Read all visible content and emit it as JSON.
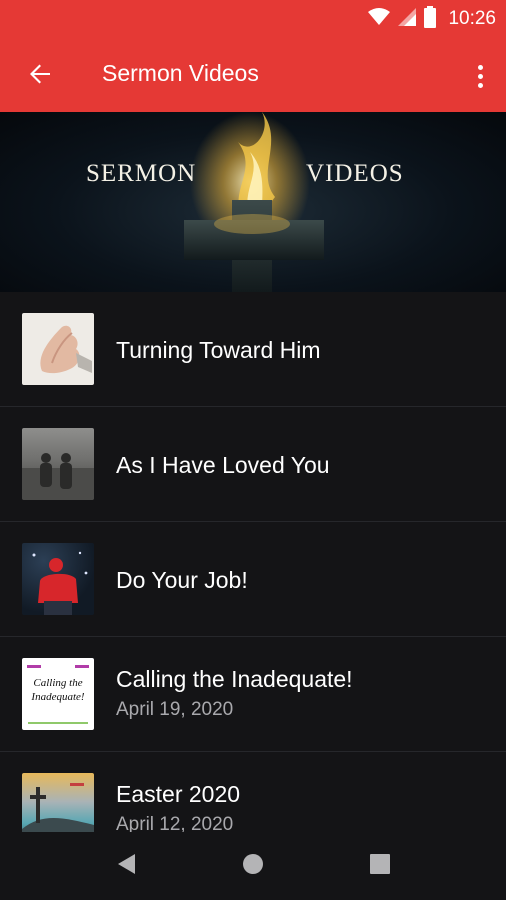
{
  "status_bar": {
    "time": "10:26",
    "icons": [
      "wifi-icon",
      "signal-icon",
      "battery-icon"
    ]
  },
  "app_bar": {
    "title": "Sermon Videos",
    "back_icon": "arrow-left-icon",
    "menu_icon": "more-vert-icon"
  },
  "banner": {
    "left_word": "SERMON",
    "right_word": "VIDEOS"
  },
  "sermons": [
    {
      "title": "Turning Toward Him",
      "date": "",
      "thumb": "praying-hands"
    },
    {
      "title": "As I Have Loved You",
      "date": "",
      "thumb": "couple-walking"
    },
    {
      "title": "Do Your Job!",
      "date": "",
      "thumb": "football-player"
    },
    {
      "title": "Calling the Inadequate!",
      "date": "April 19, 2020",
      "thumb": "handwritten-card",
      "thumb_text": "Calling the Inadequate!"
    },
    {
      "title": "Easter 2020",
      "date": "April 12, 2020",
      "thumb": "crosses-hill"
    }
  ],
  "nav_bar": {
    "icons": [
      "back-triangle-icon",
      "home-circle-icon",
      "recents-square-icon"
    ]
  },
  "colors": {
    "accent": "#e53935",
    "background": "#141416",
    "divider": "#26272b",
    "secondary_text": "#a9a9ad"
  }
}
